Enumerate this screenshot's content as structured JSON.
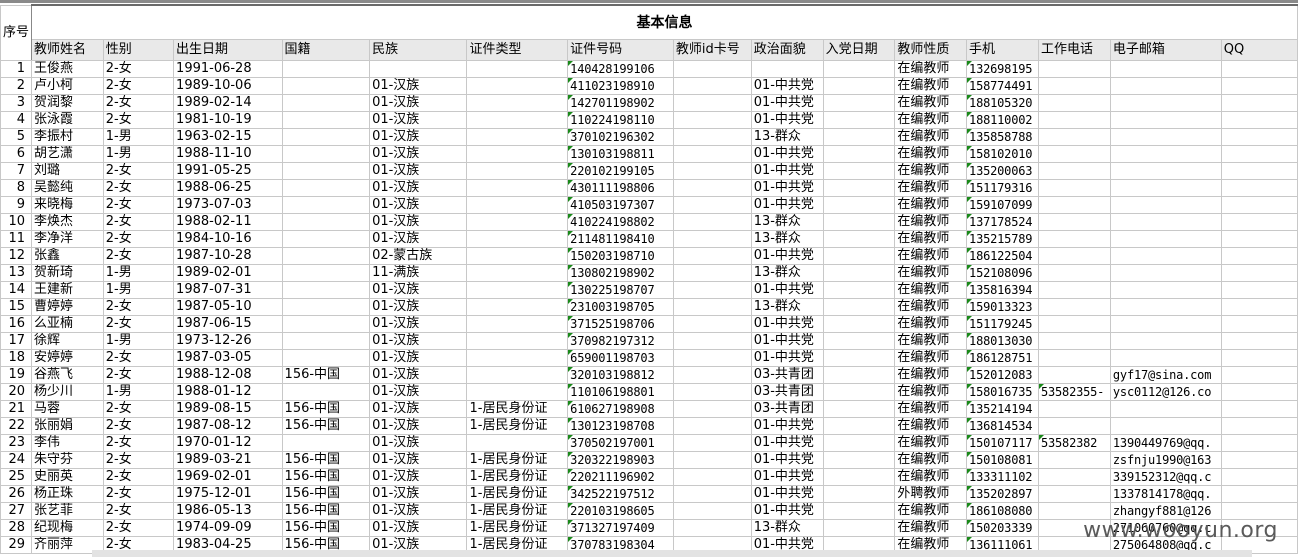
{
  "sheet": {
    "seq_header": "序号",
    "section_title": "基本信息",
    "columns": [
      "教师姓名",
      "性别",
      "出生日期",
      "国籍",
      "民族",
      "证件类型",
      "证件号码",
      "教师id卡号",
      "政治面貌",
      "入党日期",
      "教师性质",
      "手机",
      "工作电话",
      "电子邮箱",
      "QQ"
    ],
    "rows": [
      [
        "1",
        "王俊燕",
        "2-女",
        "1991-06-28",
        "",
        "",
        "",
        "140428199106",
        "",
        "",
        "",
        "在编教师",
        "132698195",
        "",
        "",
        ""
      ],
      [
        "2",
        "卢小柯",
        "2-女",
        "1989-10-06",
        "",
        "01-汉族",
        "",
        "411023198910",
        "",
        "01-中共党",
        "",
        "在编教师",
        "158774491",
        "",
        "",
        ""
      ],
      [
        "3",
        "贺润黎",
        "2-女",
        "1989-02-14",
        "",
        "01-汉族",
        "",
        "142701198902",
        "",
        "01-中共党",
        "",
        "在编教师",
        "188105320",
        "",
        "",
        ""
      ],
      [
        "4",
        "张泳霞",
        "2-女",
        "1981-10-19",
        "",
        "01-汉族",
        "",
        "110224198110",
        "",
        "01-中共党",
        "",
        "在编教师",
        "188110002",
        "",
        "",
        ""
      ],
      [
        "5",
        "李振村",
        "1-男",
        "1963-02-15",
        "",
        "01-汉族",
        "",
        "370102196302",
        "",
        "13-群众",
        "",
        "在编教师",
        "135858788",
        "",
        "",
        ""
      ],
      [
        "6",
        "胡艺潇",
        "1-男",
        "1988-11-10",
        "",
        "01-汉族",
        "",
        "130103198811",
        "",
        "01-中共党",
        "",
        "在编教师",
        "158102010",
        "",
        "",
        ""
      ],
      [
        "7",
        "刘璐",
        "2-女",
        "1991-05-25",
        "",
        "01-汉族",
        "",
        "220102199105",
        "",
        "01-中共党",
        "",
        "在编教师",
        "135200063",
        "",
        "",
        ""
      ],
      [
        "8",
        "吴懿纯",
        "2-女",
        "1988-06-25",
        "",
        "01-汉族",
        "",
        "430111198806",
        "",
        "01-中共党",
        "",
        "在编教师",
        "151179316",
        "",
        "",
        ""
      ],
      [
        "9",
        "来晓梅",
        "2-女",
        "1973-07-03",
        "",
        "01-汉族",
        "",
        "410503197307",
        "",
        "01-中共党",
        "",
        "在编教师",
        "159107099",
        "",
        "",
        ""
      ],
      [
        "10",
        "李焕杰",
        "2-女",
        "1988-02-11",
        "",
        "01-汉族",
        "",
        "410224198802",
        "",
        "13-群众",
        "",
        "在编教师",
        "137178524",
        "",
        "",
        ""
      ],
      [
        "11",
        "李净洋",
        "2-女",
        "1984-10-16",
        "",
        "01-汉族",
        "",
        "211481198410",
        "",
        "13-群众",
        "",
        "在编教师",
        "135215789",
        "",
        "",
        ""
      ],
      [
        "12",
        "张鑫",
        "2-女",
        "1987-10-28",
        "",
        "02-蒙古族",
        "",
        "150203198710",
        "",
        "01-中共党",
        "",
        "在编教师",
        "186122504",
        "",
        "",
        ""
      ],
      [
        "13",
        "贺新琦",
        "1-男",
        "1989-02-01",
        "",
        "11-满族",
        "",
        "130802198902",
        "",
        "13-群众",
        "",
        "在编教师",
        "152108096",
        "",
        "",
        ""
      ],
      [
        "14",
        "王建新",
        "1-男",
        "1987-07-31",
        "",
        "01-汉族",
        "",
        "130225198707",
        "",
        "01-中共党",
        "",
        "在编教师",
        "135816394",
        "",
        "",
        ""
      ],
      [
        "15",
        "曹婷婷",
        "2-女",
        "1987-05-10",
        "",
        "01-汉族",
        "",
        "231003198705",
        "",
        "13-群众",
        "",
        "在编教师",
        "159013323",
        "",
        "",
        ""
      ],
      [
        "16",
        "么亚楠",
        "2-女",
        "1987-06-15",
        "",
        "01-汉族",
        "",
        "371525198706",
        "",
        "01-中共党",
        "",
        "在编教师",
        "151179245",
        "",
        "",
        ""
      ],
      [
        "17",
        "徐辉",
        "1-男",
        "1973-12-26",
        "",
        "01-汉族",
        "",
        "370982197312",
        "",
        "01-中共党",
        "",
        "在编教师",
        "188013030",
        "",
        "",
        ""
      ],
      [
        "18",
        "安婷婷",
        "2-女",
        "1987-03-05",
        "",
        "01-汉族",
        "",
        "659001198703",
        "",
        "01-中共党",
        "",
        "在编教师",
        "186128751",
        "",
        "",
        ""
      ],
      [
        "19",
        "谷燕飞",
        "2-女",
        "1988-12-08",
        "156-中国",
        "01-汉族",
        "",
        "320103198812",
        "",
        "03-共青团",
        "",
        "在编教师",
        "152012083",
        "",
        "gyf17@sina.com",
        ""
      ],
      [
        "20",
        "杨少川",
        "1-男",
        "1988-01-12",
        "",
        "01-汉族",
        "",
        "110106198801",
        "",
        "03-共青团",
        "",
        "在编教师",
        "158016735",
        "53582355-",
        "ysc0112@126.co",
        ""
      ],
      [
        "21",
        "马蓉",
        "2-女",
        "1989-08-15",
        "156-中国",
        "01-汉族",
        "1-居民身份证",
        "610627198908",
        "",
        "03-共青团",
        "",
        "在编教师",
        "135214194",
        "",
        "",
        ""
      ],
      [
        "22",
        "张丽娟",
        "2-女",
        "1987-08-12",
        "156-中国",
        "01-汉族",
        "1-居民身份证",
        "130123198708",
        "",
        "01-中共党",
        "",
        "在编教师",
        "136814534",
        "",
        "",
        ""
      ],
      [
        "23",
        "李伟",
        "2-女",
        "1970-01-12",
        "",
        "01-汉族",
        "",
        "370502197001",
        "",
        "01-中共党",
        "",
        "在编教师",
        "150107117",
        "53582382",
        "1390449769@qq.",
        ""
      ],
      [
        "24",
        "朱守芬",
        "2-女",
        "1989-03-21",
        "156-中国",
        "01-汉族",
        "1-居民身份证",
        "320322198903",
        "",
        "01-中共党",
        "",
        "在编教师",
        "150108081",
        "",
        "zsfnju1990@163",
        ""
      ],
      [
        "25",
        "史丽英",
        "2-女",
        "1969-02-01",
        "156-中国",
        "01-汉族",
        "1-居民身份证",
        "220211196902",
        "",
        "01-中共党",
        "",
        "在编教师",
        "133311102",
        "",
        "339152312@qq.c",
        ""
      ],
      [
        "26",
        "杨正珠",
        "2-女",
        "1975-12-01",
        "156-中国",
        "01-汉族",
        "1-居民身份证",
        "342522197512",
        "",
        "01-中共党",
        "",
        "外聘教师",
        "135202897",
        "",
        "1337814178@qq.",
        ""
      ],
      [
        "27",
        "张艺菲",
        "2-女",
        "1986-05-13",
        "156-中国",
        "01-汉族",
        "1-居民身份证",
        "220103198605",
        "",
        "01-中共党",
        "",
        "在编教师",
        "186108080",
        "",
        "zhangyf881@126",
        ""
      ],
      [
        "28",
        "纪现梅",
        "2-女",
        "1974-09-09",
        "156-中国",
        "01-汉族",
        "1-居民身份证",
        "371327197409",
        "",
        "13-群众",
        "",
        "在编教师",
        "150203339",
        "",
        "271060760@qq.c",
        ""
      ],
      [
        "29",
        "齐丽萍",
        "2-女",
        "1983-04-25",
        "156-中国",
        "01-汉族",
        "1-居民身份证",
        "370783198304",
        "",
        "01-中共党",
        "",
        "在编教师",
        "136111061",
        "",
        "275064808@qq.c",
        ""
      ]
    ]
  },
  "watermark": "www.wooyun.org"
}
